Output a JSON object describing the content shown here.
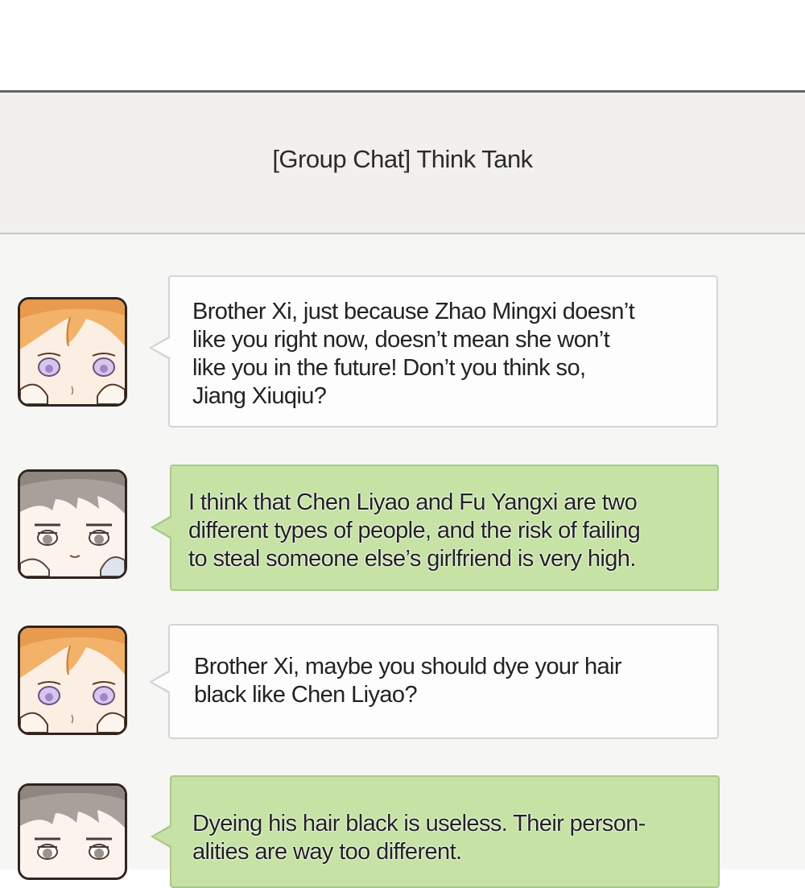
{
  "chat": {
    "title": "[Group Chat] Think Tank"
  },
  "messages": [
    {
      "sender_avatar": "orange-hair-avatar",
      "style": "received",
      "text": "Brother Xi, just because Zhao Mingxi doesn’t\nlike you right now, doesn’t mean she won’t\nlike you in the future! Don’t you think so,\nJiang Xiuqiu?"
    },
    {
      "sender_avatar": "brown-hair-avatar",
      "style": "sent",
      "text": "I think that Chen Liyao and Fu Yangxi are two\ndifferent types of people, and the risk of failing\nto steal someone else’s girlfriend is very high."
    },
    {
      "sender_avatar": "orange-hair-avatar",
      "style": "received",
      "text": "Brother Xi, maybe you should dye your hair\nblack like Chen Liyao?"
    },
    {
      "sender_avatar": "brown-hair-avatar",
      "style": "sent",
      "text": "Dyeing his hair black is useless. Their person-\nalities are way too different."
    }
  ],
  "colors": {
    "header_bg": "#f2f0ec",
    "chat_bg": "#f6f6f5",
    "received_bubble": "#fdfdfd",
    "sent_bubble": "#c6e2a5",
    "avatar_border": "#2e2420"
  }
}
